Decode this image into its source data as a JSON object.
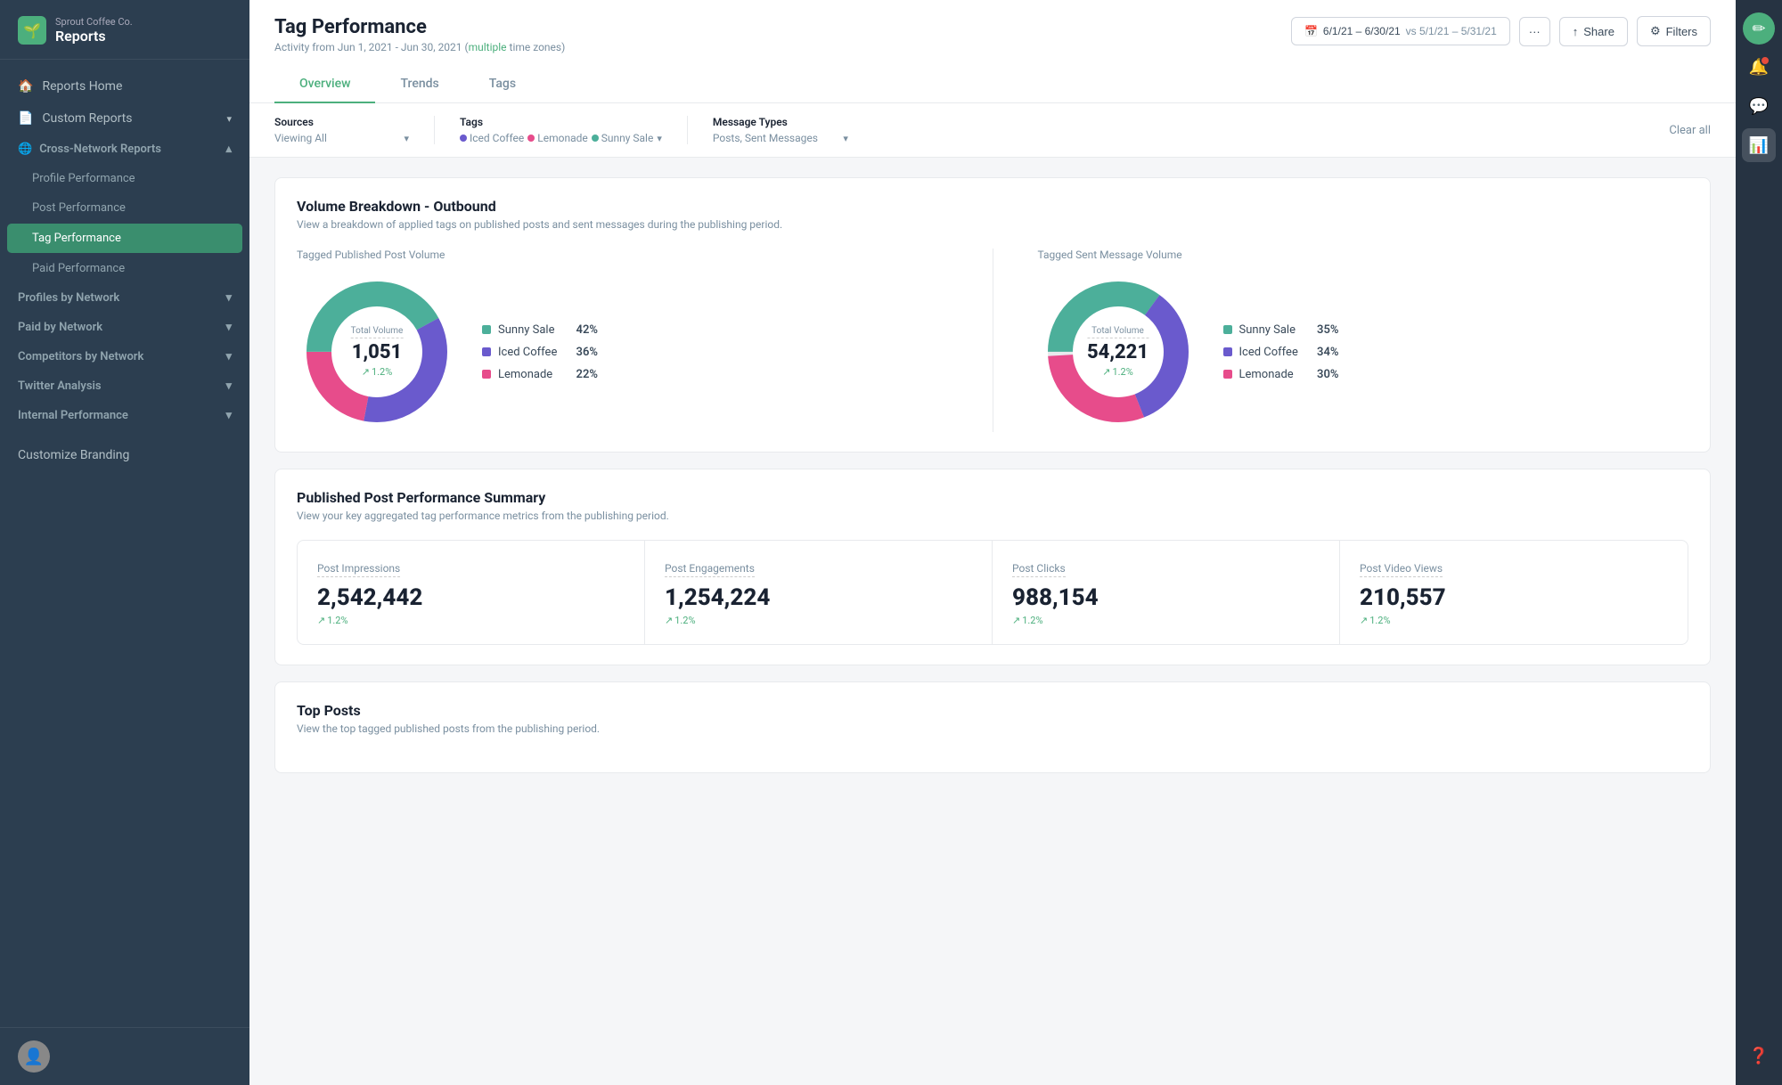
{
  "brand": {
    "company": "Sprout Coffee Co.",
    "title": "Reports"
  },
  "sidebar": {
    "nav_items": [
      {
        "label": "Reports Home",
        "icon": "🏠",
        "type": "top"
      },
      {
        "label": "Custom Reports",
        "icon": "📄",
        "type": "top",
        "chevron": true
      },
      {
        "label": "Cross-Network Reports",
        "icon": "🌐",
        "type": "section",
        "expanded": true
      },
      {
        "label": "Profile Performance",
        "type": "sub"
      },
      {
        "label": "Post Performance",
        "type": "sub"
      },
      {
        "label": "Tag Performance",
        "type": "sub",
        "active": true
      },
      {
        "label": "Paid Performance",
        "type": "sub"
      },
      {
        "label": "Profiles by Network",
        "type": "group",
        "chevron": true
      },
      {
        "label": "Paid by Network",
        "type": "group",
        "chevron": true
      },
      {
        "label": "Competitors by Network",
        "type": "group",
        "chevron": true
      },
      {
        "label": "Twitter Analysis",
        "type": "group",
        "chevron": true
      },
      {
        "label": "Internal Performance",
        "type": "group",
        "chevron": true
      },
      {
        "label": "Customize Branding",
        "type": "bottom"
      }
    ]
  },
  "header": {
    "title": "Tag Performance",
    "subtitle": "Activity from Jun 1, 2021 - Jun 30, 2021",
    "subtitle_link": "multiple",
    "subtitle_suffix": "time zones)",
    "date_range": "6/1/21 – 6/30/21",
    "vs_range": "vs 5/1/21 – 5/31/21",
    "share_label": "Share",
    "filters_label": "Filters"
  },
  "filters": {
    "sources_label": "Sources",
    "sources_value": "Viewing All",
    "tags_label": "Tags",
    "tags": [
      {
        "name": "Iced Coffee",
        "color": "#6a5acd"
      },
      {
        "name": "Lemonade",
        "color": "#e74c8b"
      },
      {
        "name": "Sunny Sale",
        "color": "#4caf7d"
      }
    ],
    "message_types_label": "Message Types",
    "message_types_value": "Posts, Sent Messages",
    "clear_all": "Clear all"
  },
  "tabs": [
    {
      "label": "Overview",
      "active": true
    },
    {
      "label": "Trends",
      "active": false
    },
    {
      "label": "Tags",
      "active": false
    }
  ],
  "volume_breakdown": {
    "section_title": "Volume Breakdown - Outbound",
    "section_subtitle": "View a breakdown of applied tags on published posts and sent messages during the publishing period.",
    "published_chart": {
      "title": "Tagged Published Post Volume",
      "center_label": "Total Volume",
      "center_value": "1,051",
      "center_change": "1.2%",
      "legend": [
        {
          "name": "Sunny Sale",
          "pct": "42%",
          "color": "#4caf9a"
        },
        {
          "name": "Iced Coffee",
          "pct": "36%",
          "color": "#6a5acd"
        },
        {
          "name": "Lemonade",
          "pct": "22%",
          "color": "#e74c8b"
        }
      ],
      "segments": [
        {
          "pct": 42,
          "color": "#4caf9a"
        },
        {
          "pct": 36,
          "color": "#6a5acd"
        },
        {
          "pct": 22,
          "color": "#e74c8b"
        }
      ]
    },
    "sent_chart": {
      "title": "Tagged Sent Message Volume",
      "center_label": "Total Volume",
      "center_value": "54,221",
      "center_change": "1.2%",
      "legend": [
        {
          "name": "Sunny Sale",
          "pct": "35%",
          "color": "#4caf9a"
        },
        {
          "name": "Iced Coffee",
          "pct": "34%",
          "color": "#6a5acd"
        },
        {
          "name": "Lemonade",
          "pct": "30%",
          "color": "#e74c8b"
        }
      ],
      "segments": [
        {
          "pct": 35,
          "color": "#4caf9a"
        },
        {
          "pct": 34,
          "color": "#6a5acd"
        },
        {
          "pct": 30,
          "color": "#e74c8b"
        }
      ]
    }
  },
  "performance_summary": {
    "section_title": "Published Post Performance Summary",
    "section_subtitle": "View your key aggregated tag performance metrics from the publishing period.",
    "stats": [
      {
        "label": "Post Impressions",
        "value": "2,542,442",
        "change": "1.2%"
      },
      {
        "label": "Post Engagements",
        "value": "1,254,224",
        "change": "1.2%"
      },
      {
        "label": "Post Clicks",
        "value": "988,154",
        "change": "1.2%"
      },
      {
        "label": "Post Video Views",
        "value": "210,557",
        "change": "1.2%"
      }
    ]
  },
  "top_posts": {
    "section_title": "Top Posts",
    "section_subtitle": "View the top tagged published posts from the publishing period."
  },
  "colors": {
    "accent": "#4caf7d",
    "sidebar_bg": "#2c3e50",
    "rail_bg": "#263342"
  }
}
